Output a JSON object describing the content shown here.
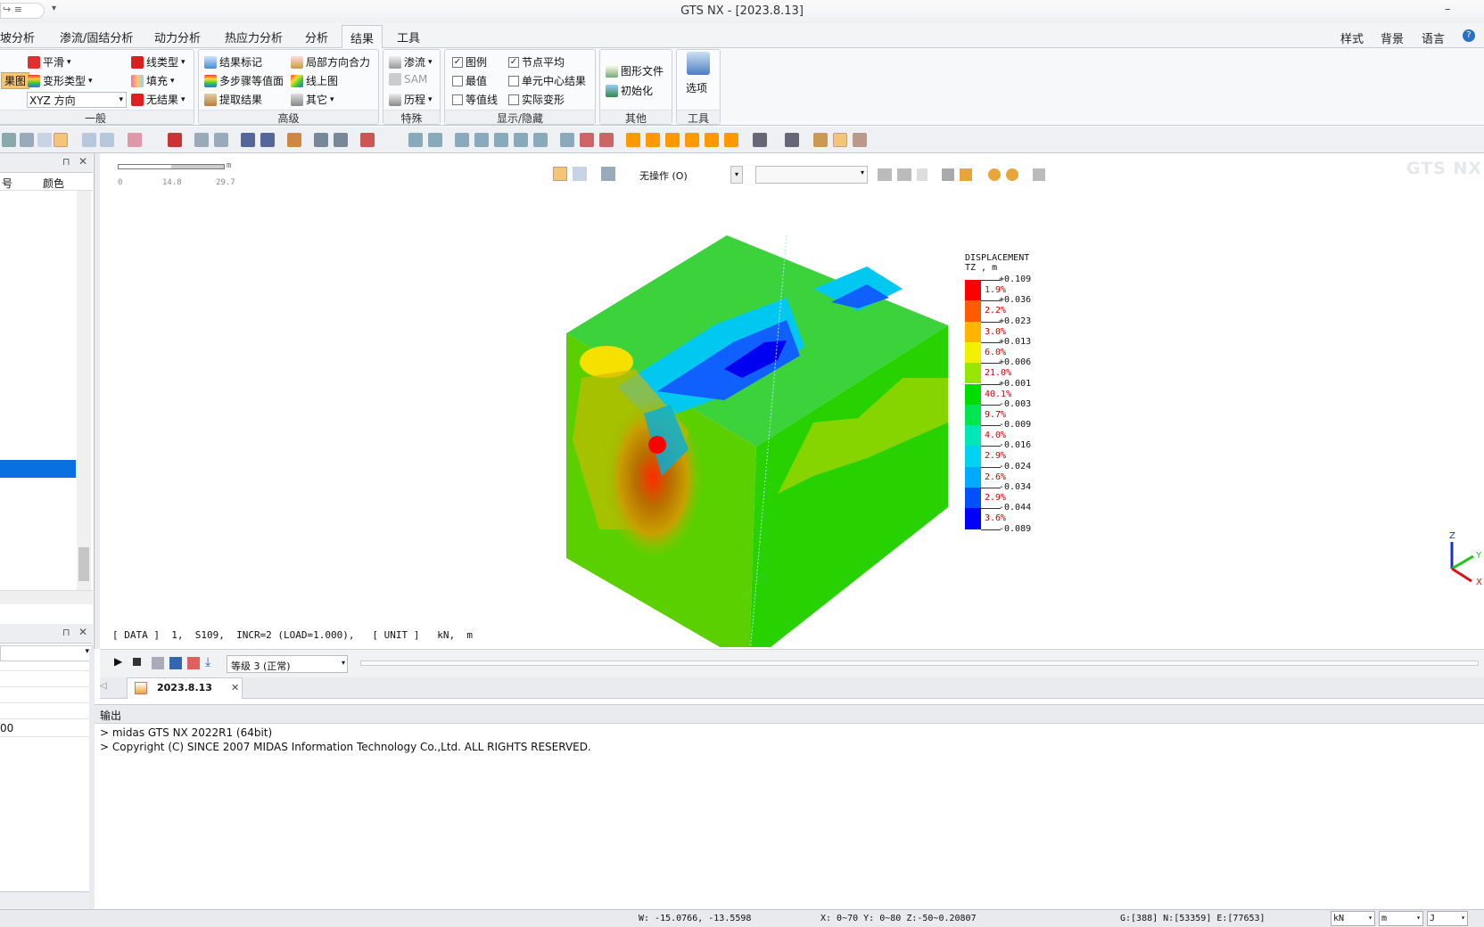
{
  "app": {
    "title": "GTS NX - [2023.8.13]"
  },
  "menu_tabs": [
    "坡分析",
    "渗流/固结分析",
    "动力分析",
    "热应力分析",
    "分析",
    "结果",
    "工具"
  ],
  "active_tab": "结果",
  "menu_right": [
    "样式",
    "背景",
    "语言"
  ],
  "ribbon": {
    "general": {
      "label": "一般",
      "items": [
        "平滑",
        "变形类型",
        "果图",
        "XYZ 方向",
        "线类型",
        "填充",
        "无结果"
      ]
    },
    "advanced": {
      "label": "高级",
      "items": [
        "结果标记",
        "多步骤等值面",
        "提取结果",
        "局部方向合力",
        "线上图",
        "其它"
      ]
    },
    "special": {
      "label": "特殊",
      "items": [
        "渗流",
        "SAM",
        "历程"
      ]
    },
    "display": {
      "label": "显示/隐藏",
      "items": [
        "图例",
        "最值",
        "等值线",
        "节点平均",
        "单元中心结果",
        "实际变形"
      ]
    },
    "other": {
      "label": "其他",
      "items": [
        "图形文件",
        "初始化"
      ]
    },
    "tools": {
      "label": "工具",
      "items": [
        "选项"
      ]
    }
  },
  "left_panel": {
    "col1": "号",
    "col2": "颜色",
    "value_fragment": "00"
  },
  "viewport": {
    "scale": {
      "unit": "m",
      "ticks": [
        "0",
        "14.8",
        "29.7"
      ]
    },
    "operation_select": "无操作 (O)",
    "logo": "GTS NX",
    "info_line": "[ DATA ]  1,  S109,  INCR=2 (LOAD=1.000),   [ UNIT ]   kN,  m",
    "axis": {
      "z": "Z",
      "y": "Y",
      "x": "X"
    }
  },
  "legend": {
    "title": "DISPLACEMENT",
    "subtitle": "TZ , m",
    "values": [
      "+0.109",
      "+0.036",
      "+0.023",
      "+0.013",
      "+0.006",
      "+0.001",
      "-0.003",
      "-0.009",
      "-0.016",
      "-0.024",
      "-0.034",
      "-0.044",
      "-0.089"
    ],
    "percents": [
      "1.9%",
      "2.2%",
      "3.0%",
      "6.0%",
      "21.0%",
      "40.1%",
      "9.7%",
      "4.0%",
      "2.9%",
      "2.6%",
      "2.9%",
      "3.6%"
    ],
    "colors": [
      "#ff0000",
      "#ff5a00",
      "#ffb400",
      "#f0f000",
      "#96e600",
      "#00dc00",
      "#00e650",
      "#00e6b4",
      "#00d2f0",
      "#00aaff",
      "#0050ff",
      "#0000ff"
    ]
  },
  "playbar": {
    "level": "等级 3 (正常)"
  },
  "doc_tab": "2023.8.13",
  "output": {
    "title": "输出",
    "lines": [
      "> midas GTS NX 2022R1 (64bit)",
      "> Copyright (C) SINCE 2007 MIDAS Information Technology Co.,Ltd. ALL RIGHTS RESERVED."
    ]
  },
  "status": {
    "w": "W: -15.0766, -13.5598",
    "xyz": "X: 0~70 Y: 0~80 Z:-50~0.20807",
    "counts": "G:[388] N:[53359] E:[77653]",
    "unit_force": "kN",
    "unit_len": "m",
    "unit_e": "J"
  }
}
